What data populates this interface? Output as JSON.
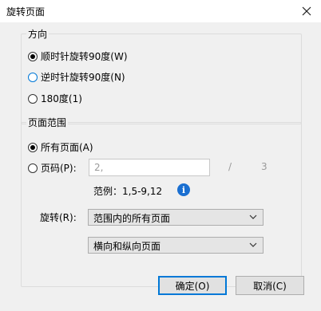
{
  "window": {
    "title": "旋转页面",
    "close_icon": "close-icon"
  },
  "direction_group": {
    "legend": "方向",
    "options": [
      {
        "label": "顺时针旋转90度(W)",
        "checked": true
      },
      {
        "label": "逆时针旋转90度(N)",
        "checked": false
      },
      {
        "label": "180度(1)",
        "checked": false
      }
    ]
  },
  "range_group": {
    "legend": "页面范围",
    "all_pages_label": "所有页面(A)",
    "all_pages_checked": true,
    "page_code_label": "页码(P):",
    "page_code_checked": false,
    "page_input_value": "2,",
    "page_separator": "/",
    "total_pages": "3",
    "example_text": "范例：1,5-9,12",
    "info_icon": "info-icon",
    "rotate_label": "旋转(R):",
    "rotate_select_value": "范围内的所有页面",
    "orientation_select_value": "横向和纵向页面"
  },
  "buttons": {
    "ok_label": "确定(O)",
    "cancel_label": "取消(C)"
  }
}
